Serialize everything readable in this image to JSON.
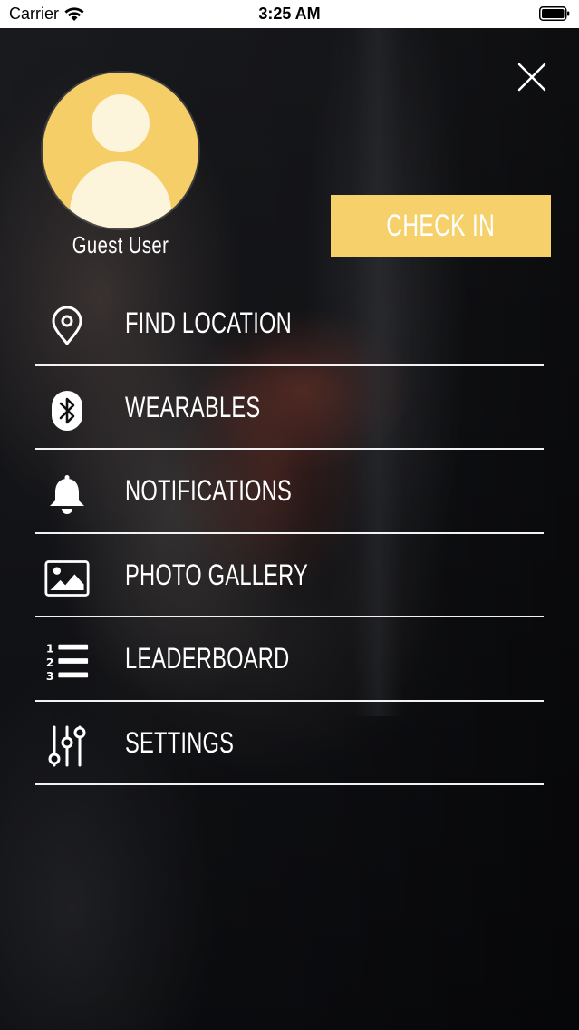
{
  "status_bar": {
    "carrier": "Carrier",
    "time": "3:25 AM",
    "icons": [
      "wifi-icon",
      "battery-icon"
    ]
  },
  "profile": {
    "name": "Guest User",
    "avatar_icon": "default-avatar-icon",
    "avatar_color": "#F5CE67"
  },
  "actions": {
    "check_in_label": "CHECK IN",
    "check_in_color": "#F6D06A",
    "close_icon": "close-icon"
  },
  "menu": {
    "items": [
      {
        "label": "FIND LOCATION",
        "icon": "location-pin-icon"
      },
      {
        "label": "WEARABLES",
        "icon": "bluetooth-icon"
      },
      {
        "label": "NOTIFICATIONS",
        "icon": "bell-icon"
      },
      {
        "label": "PHOTO GALLERY",
        "icon": "photo-icon"
      },
      {
        "label": "LEADERBOARD",
        "icon": "ranked-list-icon"
      },
      {
        "label": "SETTINGS",
        "icon": "sliders-icon"
      }
    ]
  }
}
